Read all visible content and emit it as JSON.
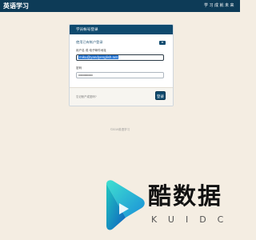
{
  "header": {
    "brand": "英语学习",
    "slogan": "学习成就未来",
    "bg_color": "#0d3b57"
  },
  "login": {
    "title": "学员帐号登录",
    "existing_account": "使用已有帐户登录",
    "help_icon": "help-badge",
    "username_label": "用户名 或 电子邮件地址",
    "username_value": "miku@yandyenglish.net",
    "password_label": "密码",
    "password_value": "••••••••••••••••",
    "forgot_link": "忘记帐户或密码?",
    "login_button": "登录",
    "accent_color": "#0f4a6e"
  },
  "footer": {
    "copyright": "©2019英语学习"
  },
  "watermark": {
    "icon": "play-logo-icon",
    "text": "酷数据",
    "subtext": "KUIDC"
  }
}
